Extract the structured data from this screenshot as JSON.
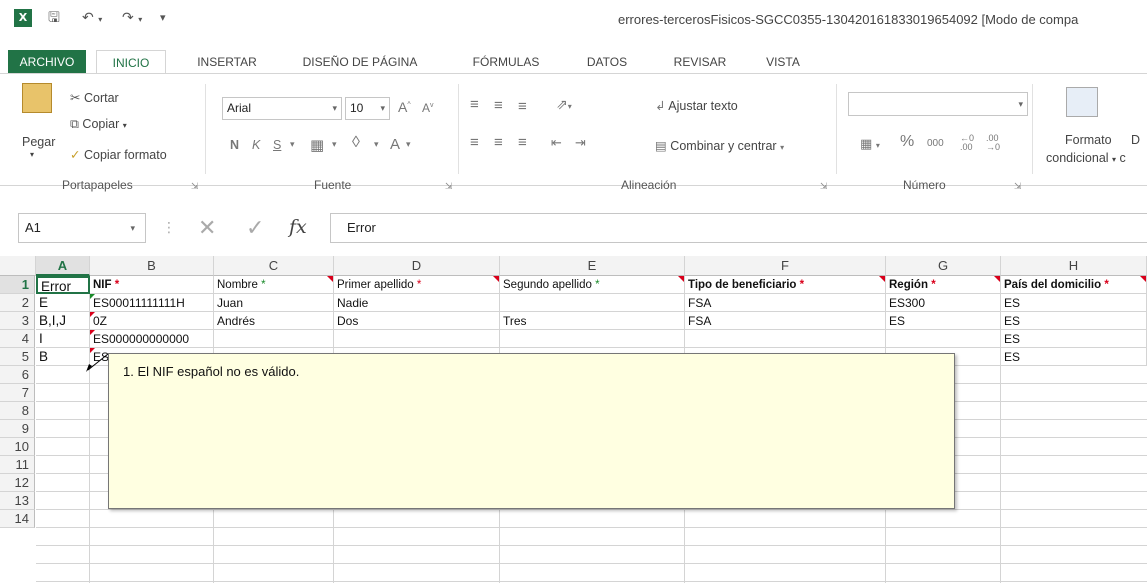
{
  "titlebar": {
    "logo": "X",
    "title": "errores-tercerosFisicos-SGCC0355-13042016183301965409​2 [Modo de compa",
    "save_icon": "save-icon",
    "undo_icon": "undo-icon",
    "redo_icon": "redo-icon"
  },
  "tabs": [
    "ARCHIVO",
    "INICIO",
    "INSERTAR",
    "DISEÑO DE PÁGINA",
    "FÓRMULAS",
    "DATOS",
    "REVISAR",
    "VISTA"
  ],
  "ribbon": {
    "clipboard": {
      "paste": "Pegar",
      "cut": "Cortar",
      "copy": "Copiar",
      "format_painter": "Copiar formato",
      "label": "Portapapeles"
    },
    "font": {
      "family": "Arial",
      "size": "10",
      "bold": "N",
      "italic": "K",
      "underline": "S",
      "label": "Fuente"
    },
    "alignment": {
      "wrap": "Ajustar texto",
      "merge": "Combinar y centrar",
      "label": "Alineación"
    },
    "number": {
      "percent": "%",
      "thousands": "000",
      "label": "Número"
    },
    "styles": {
      "conditional_1": "Formato",
      "conditional_2": "condicional"
    }
  },
  "formula_bar": {
    "name_box": "A1",
    "fx": "fx",
    "content": "Error"
  },
  "grid": {
    "columns": [
      "A",
      "B",
      "C",
      "D",
      "E",
      "F",
      "G",
      "H"
    ],
    "rows": [
      "1",
      "2",
      "3",
      "4",
      "5",
      "6",
      "7",
      "8",
      "9",
      "10",
      "11",
      "12",
      "13",
      "14"
    ],
    "header_row": {
      "a": "Error",
      "b": "NIF",
      "c": "Nombre",
      "d": "Primer apellido",
      "e": "Segundo apellido",
      "f": "Tipo de beneficiario",
      "g": "Región",
      "h": "País del domicilio",
      "star": "*"
    },
    "data": [
      {
        "a": "E",
        "b": "ES00011111111H",
        "c": "Juan",
        "d": "Nadie",
        "e": "",
        "f": "FSA",
        "g": "ES300",
        "h": "ES"
      },
      {
        "a": "B,I,J",
        "b": "0Z",
        "c": "Andrés",
        "d": "Dos",
        "e": "Tres",
        "f": "FSA",
        "g": "ES",
        "h": "ES"
      },
      {
        "a": "I",
        "b": "ES000000000000",
        "c": "",
        "d": "",
        "e": "",
        "f": "",
        "g": "",
        "h": "ES"
      },
      {
        "a": "B",
        "b": "ES",
        "c": "",
        "d": "",
        "e": "",
        "f": "",
        "g": "",
        "h": "ES"
      }
    ]
  },
  "comment": {
    "text": "1. El NIF español no es válido."
  },
  "colors": {
    "excel_green": "#217346",
    "comment_bg": "#ffffe1",
    "required_star": "#d9001b",
    "optional_star": "#1a8a2a"
  }
}
